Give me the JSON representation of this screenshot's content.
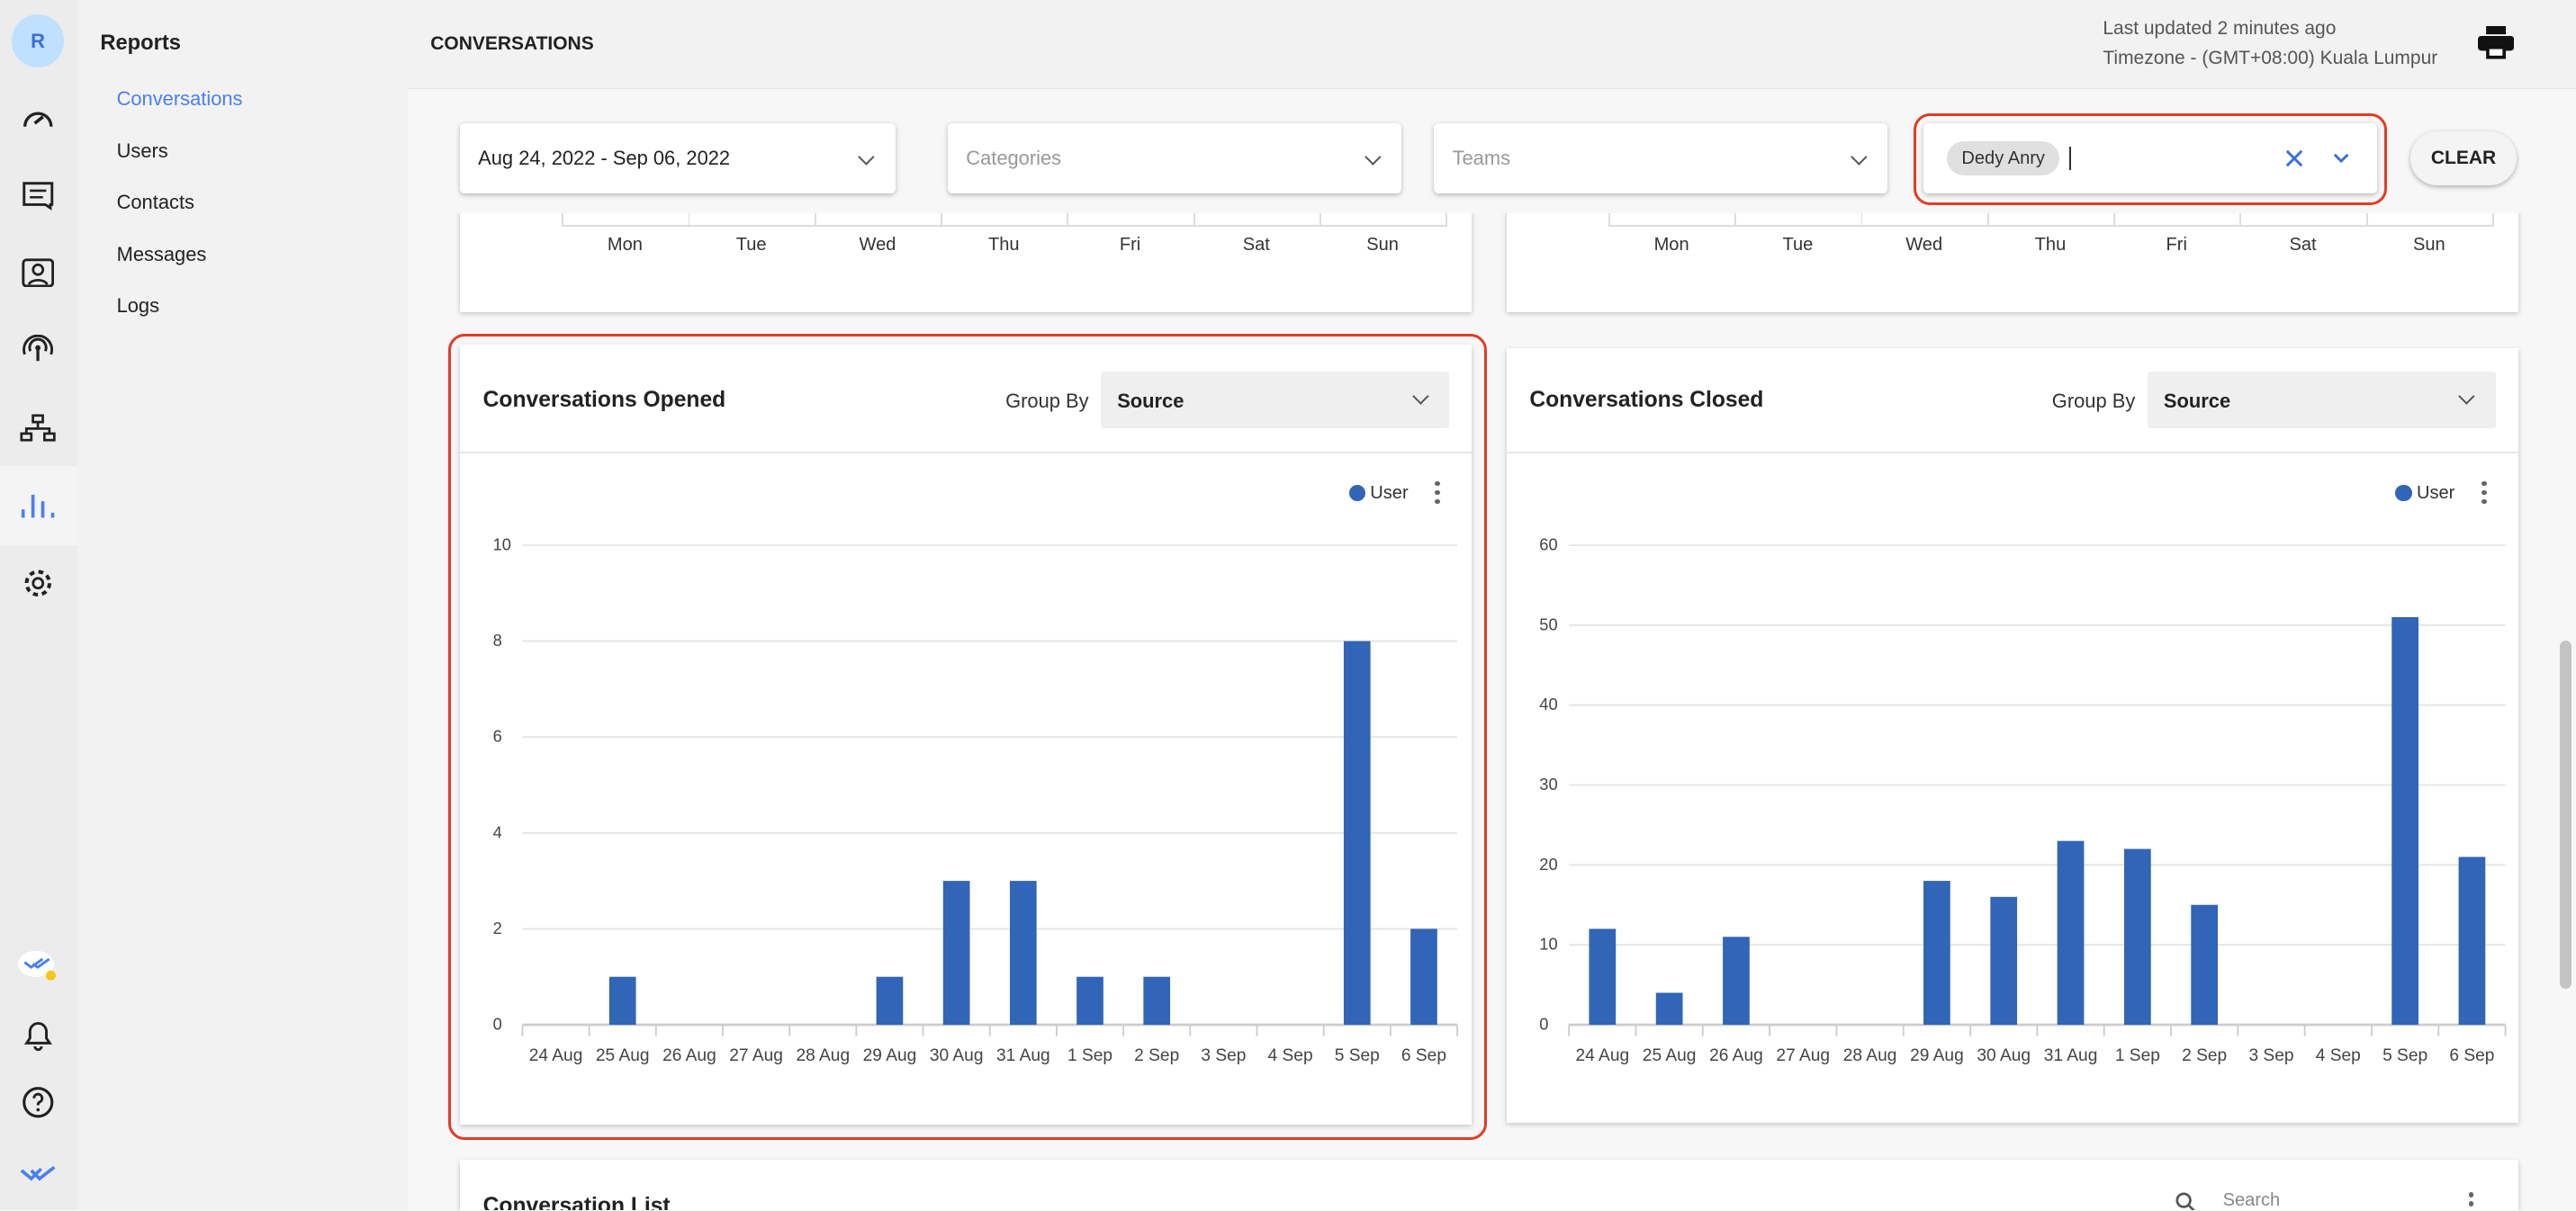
{
  "rail": {
    "avatar": "R",
    "icons": [
      "dashboard-icon",
      "chat-icon",
      "contact-icon",
      "broadcast-icon",
      "workflow-icon",
      "reports-icon",
      "settings-icon",
      "checkmark-badge-icon",
      "bell-icon",
      "help-icon",
      "logo-icon"
    ]
  },
  "sidebar": {
    "heading": "Reports",
    "items": [
      {
        "label": "Conversations",
        "active": true
      },
      {
        "label": "Users"
      },
      {
        "label": "Contacts"
      },
      {
        "label": "Messages"
      },
      {
        "label": "Logs"
      }
    ]
  },
  "header": {
    "title": "CONVERSATIONS",
    "updated": "Last updated 2 minutes ago",
    "timezone": "Timezone - (GMT+08:00) Kuala Lumpur"
  },
  "filters": {
    "date": "Aug 24, 2022 - Sep 06, 2022",
    "categories_placeholder": "Categories",
    "teams_placeholder": "Teams",
    "user_chip": "Dedy Anry",
    "clear": "CLEAR"
  },
  "weekdays": [
    "Mon",
    "Tue",
    "Wed",
    "Thu",
    "Fri",
    "Sat",
    "Sun"
  ],
  "colors": {
    "accent": "#4a80f0",
    "bar": "#3065b7",
    "highlight": "#e53b24"
  },
  "chart_data": [
    {
      "type": "bar",
      "title": "Conversations Opened",
      "group_by_label": "Group By",
      "group_by": "Source",
      "legend": "User",
      "categories": [
        "24 Aug",
        "25 Aug",
        "26 Aug",
        "27 Aug",
        "28 Aug",
        "29 Aug",
        "30 Aug",
        "31 Aug",
        "1 Sep",
        "2 Sep",
        "3 Sep",
        "4 Sep",
        "5 Sep",
        "6 Sep"
      ],
      "series": [
        {
          "name": "User",
          "values": [
            0,
            1,
            0,
            0,
            0,
            1,
            3,
            3,
            1,
            1,
            0,
            0,
            8,
            2
          ]
        }
      ],
      "ylim": [
        0,
        10
      ],
      "yticks": [
        0,
        2,
        4,
        6,
        8,
        10
      ],
      "grid": true,
      "legend_position": "top-right"
    },
    {
      "type": "bar",
      "title": "Conversations Closed",
      "group_by_label": "Group By",
      "group_by": "Source",
      "legend": "User",
      "categories": [
        "24 Aug",
        "25 Aug",
        "26 Aug",
        "27 Aug",
        "28 Aug",
        "29 Aug",
        "30 Aug",
        "31 Aug",
        "1 Sep",
        "2 Sep",
        "3 Sep",
        "4 Sep",
        "5 Sep",
        "6 Sep"
      ],
      "series": [
        {
          "name": "User",
          "values": [
            12,
            4,
            11,
            0,
            0,
            18,
            16,
            23,
            22,
            15,
            0,
            0,
            51,
            21
          ]
        }
      ],
      "ylim": [
        0,
        60
      ],
      "yticks": [
        0,
        10,
        20,
        30,
        40,
        50,
        60
      ],
      "grid": true,
      "legend_position": "top-right"
    }
  ],
  "list": {
    "title": "Conversation List",
    "search_placeholder": "Search"
  }
}
